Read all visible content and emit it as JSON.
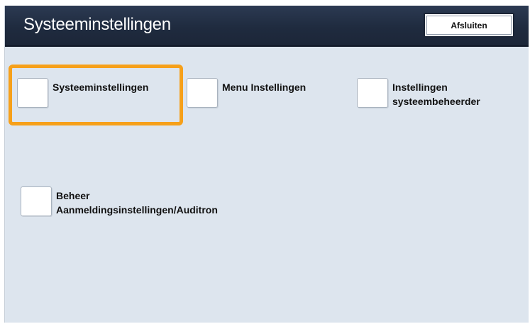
{
  "header": {
    "title": "Systeeminstellingen",
    "exit_label": "Afsluiten"
  },
  "options": [
    {
      "label_line1": "Systeeminstellingen",
      "label_line2": ""
    },
    {
      "label_line1": "Menu Instellingen",
      "label_line2": ""
    },
    {
      "label_line1": "Instellingen",
      "label_line2": "systeembeheerder"
    },
    {
      "label_line1": "Beheer",
      "label_line2": "Aanmeldingsinstellingen/Auditron"
    }
  ],
  "colors": {
    "titlebar": "#1f2b3f",
    "background": "#dde5ee",
    "highlight": "#f6a01a"
  },
  "selected_option": "Systeeminstellingen"
}
